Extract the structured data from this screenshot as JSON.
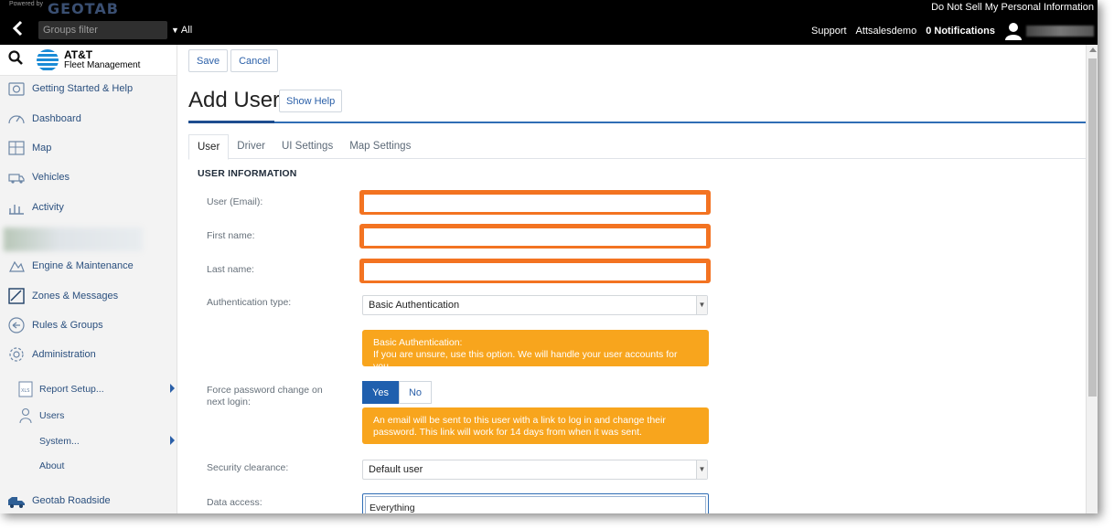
{
  "topbar": {
    "powered_by": "Powered by",
    "brand": "GEOTAB",
    "do_not_sell": "Do Not Sell My Personal Information",
    "groups_filter_placeholder": "Groups filter",
    "all_label": "All",
    "support": "Support",
    "account": "Attsalesdemo",
    "notifications": "0 Notifications"
  },
  "sidebar": {
    "logo_line1": "AT&T",
    "logo_line2": "Fleet Management",
    "items": [
      {
        "label": "Getting Started & Help",
        "icon": "help-box-icon"
      },
      {
        "label": "Dashboard",
        "icon": "gauge-icon"
      },
      {
        "label": "Map",
        "icon": "map-icon"
      },
      {
        "label": "Vehicles",
        "icon": "truck-icon"
      },
      {
        "label": "Activity",
        "icon": "bar-chart-icon"
      },
      {
        "label": "Engine & Maintenance",
        "icon": "engine-icon"
      },
      {
        "label": "Zones & Messages",
        "icon": "zone-icon"
      },
      {
        "label": "Rules & Groups",
        "icon": "rules-icon"
      },
      {
        "label": "Administration",
        "icon": "gear-icon"
      }
    ],
    "sub_items": [
      {
        "label": "Report Setup...",
        "icon": "xls-icon"
      },
      {
        "label": "Users",
        "icon": "user-icon"
      },
      {
        "label": "System..."
      },
      {
        "label": "About"
      }
    ],
    "roadside": "Geotab Roadside"
  },
  "toolbar": {
    "save_label": "Save",
    "cancel_label": "Cancel"
  },
  "page": {
    "title": "Add User",
    "show_help": "Show Help"
  },
  "tabs": [
    "User",
    "Driver",
    "UI Settings",
    "Map Settings"
  ],
  "form": {
    "section_title": "USER INFORMATION",
    "user_email_label": "User (Email):",
    "first_name_label": "First name:",
    "last_name_label": "Last name:",
    "auth_type_label": "Authentication type:",
    "auth_type_value": "Basic Authentication",
    "auth_info_title": "Basic Authentication:",
    "auth_info_text": "If you are unsure, use this option. We will handle your user accounts for you.",
    "force_pw_label": "Force password change on next login:",
    "yes_label": "Yes",
    "no_label": "No",
    "force_pw_info": "An email will be sent to this user with a link to log in and change their password. This link will work for 14 days from when it was sent.",
    "security_label": "Security clearance:",
    "security_value": "Default user",
    "data_access_label": "Data access:",
    "data_access_value": "Everything"
  },
  "colors": {
    "highlight": "#f37321",
    "info_box": "#f8a51d",
    "link_blue": "#2a5fa8",
    "toggle_active": "#1f5fae"
  }
}
